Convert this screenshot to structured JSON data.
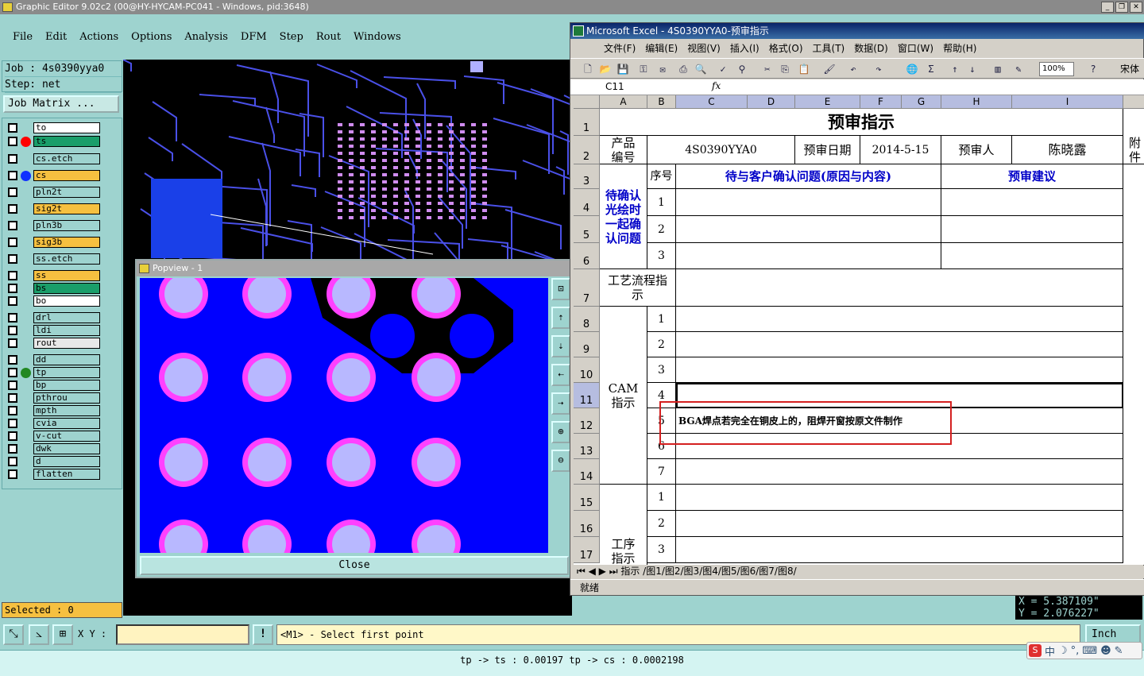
{
  "ge": {
    "title": "Graphic Editor 9.02c2 (00@HY-HYCAM-PC041 - Windows, pid:3648)",
    "menu": [
      "File",
      "Edit",
      "Actions",
      "Options",
      "Analysis",
      "DFM",
      "Step",
      "Rout",
      "Windows"
    ],
    "job": "Job : 4s0390yya0",
    "step": "Step: net",
    "job_matrix": "Job Matrix ...",
    "layers": [
      {
        "name": "to",
        "color": "#ffffff",
        "dot": ""
      },
      {
        "name": "ts",
        "color": "#1a9e6a",
        "dot": "#ff0000"
      },
      {
        "name": "cs.etch",
        "color": "#9ed3cf",
        "dot": ""
      },
      {
        "name": "cs",
        "color": "#f6c040",
        "dot": "#1030ff"
      },
      {
        "name": "pln2t",
        "color": "#9ed3cf",
        "dot": ""
      },
      {
        "name": "sig2t",
        "color": "#f6c040",
        "dot": ""
      },
      {
        "name": "pln3b",
        "color": "#9ed3cf",
        "dot": ""
      },
      {
        "name": "sig3b",
        "color": "#f6c040",
        "dot": ""
      },
      {
        "name": "ss.etch",
        "color": "#9ed3cf",
        "dot": ""
      },
      {
        "name": "ss",
        "color": "#f6c040",
        "dot": ""
      },
      {
        "name": "bs",
        "color": "#1a9e6a",
        "dot": ""
      },
      {
        "name": "bo",
        "color": "#ffffff",
        "dot": ""
      },
      {
        "name": "drl",
        "color": "#9ed3cf",
        "dot": ""
      },
      {
        "name": "ldi",
        "color": "#9ed3cf",
        "dot": ""
      },
      {
        "name": "rout",
        "color": "#e8e8e8",
        "dot": ""
      },
      {
        "name": "dd",
        "color": "#9ed3cf",
        "dot": ""
      },
      {
        "name": "tp",
        "color": "#9ed3cf",
        "dot": "#228822"
      },
      {
        "name": "bp",
        "color": "#9ed3cf",
        "dot": ""
      },
      {
        "name": "pthrou",
        "color": "#9ed3cf",
        "dot": ""
      },
      {
        "name": "mpth",
        "color": "#9ed3cf",
        "dot": ""
      },
      {
        "name": "cvia",
        "color": "#9ed3cf",
        "dot": ""
      },
      {
        "name": "v-cut",
        "color": "#9ed3cf",
        "dot": ""
      },
      {
        "name": "dwk",
        "color": "#9ed3cf",
        "dot": ""
      },
      {
        "name": "d",
        "color": "#9ed3cf",
        "dot": ""
      },
      {
        "name": "flatten",
        "color": "#9ed3cf",
        "dot": ""
      }
    ],
    "selected": "Selected : 0",
    "popview_title": "Popview - 1",
    "close": "Close",
    "xy_label": "X Y :",
    "message": "<M1> - Select first point",
    "units": "Inch",
    "coord_x": "X = 5.387109\"",
    "coord_y": "Y = 2.076227\"",
    "status": "tp -> ts : 0.00197    tp -> cs : 0.0002198",
    "excl_label": "!"
  },
  "xl": {
    "title": "Microsoft Excel - 4S0390YYA0-预审指示",
    "menu": [
      "文件(F)",
      "编辑(E)",
      "视图(V)",
      "插入(I)",
      "格式(O)",
      "工具(T)",
      "数据(D)",
      "窗口(W)",
      "帮助(H)"
    ],
    "zoom": "100%",
    "font": "宋体",
    "namebox": "C11",
    "fx": "fx",
    "cols": [
      "A",
      "B",
      "C",
      "D",
      "E",
      "F",
      "G",
      "H",
      "I"
    ],
    "rows": [
      "1",
      "2",
      "3",
      "4",
      "5",
      "6",
      "7",
      "8",
      "9",
      "10",
      "11",
      "12",
      "13",
      "14",
      "15",
      "16",
      "17"
    ],
    "heading": "预审指示",
    "product_label": "产品编号",
    "product_no": "4S0390YYA0",
    "date_label": "预审日期",
    "date": "2014-5-15",
    "reviewer_label": "预审人",
    "reviewer": "陈晓露",
    "attach": "附件",
    "seq_label": "序号",
    "confirm_label": "待与客户确认问题(原因与内容)",
    "advice_label": "预审建议",
    "confirm_group": "待确认光绘时一起确认问题",
    "process_label": "工艺流程指示",
    "cam_label": "CAM指示",
    "proc_label": "工序指示",
    "cam_note": "BGA焊点若完全在铜皮上的，阻焊开窗按原文件制作",
    "n1": "1",
    "n2": "2",
    "n3": "3",
    "n4": "4",
    "n5": "5",
    "n6": "6",
    "n7": "7",
    "tabs": "指示 /图1/图2/图3/图4/图5/图6/图7/图8/",
    "status": "就绪"
  },
  "ime": {
    "label": "中"
  }
}
